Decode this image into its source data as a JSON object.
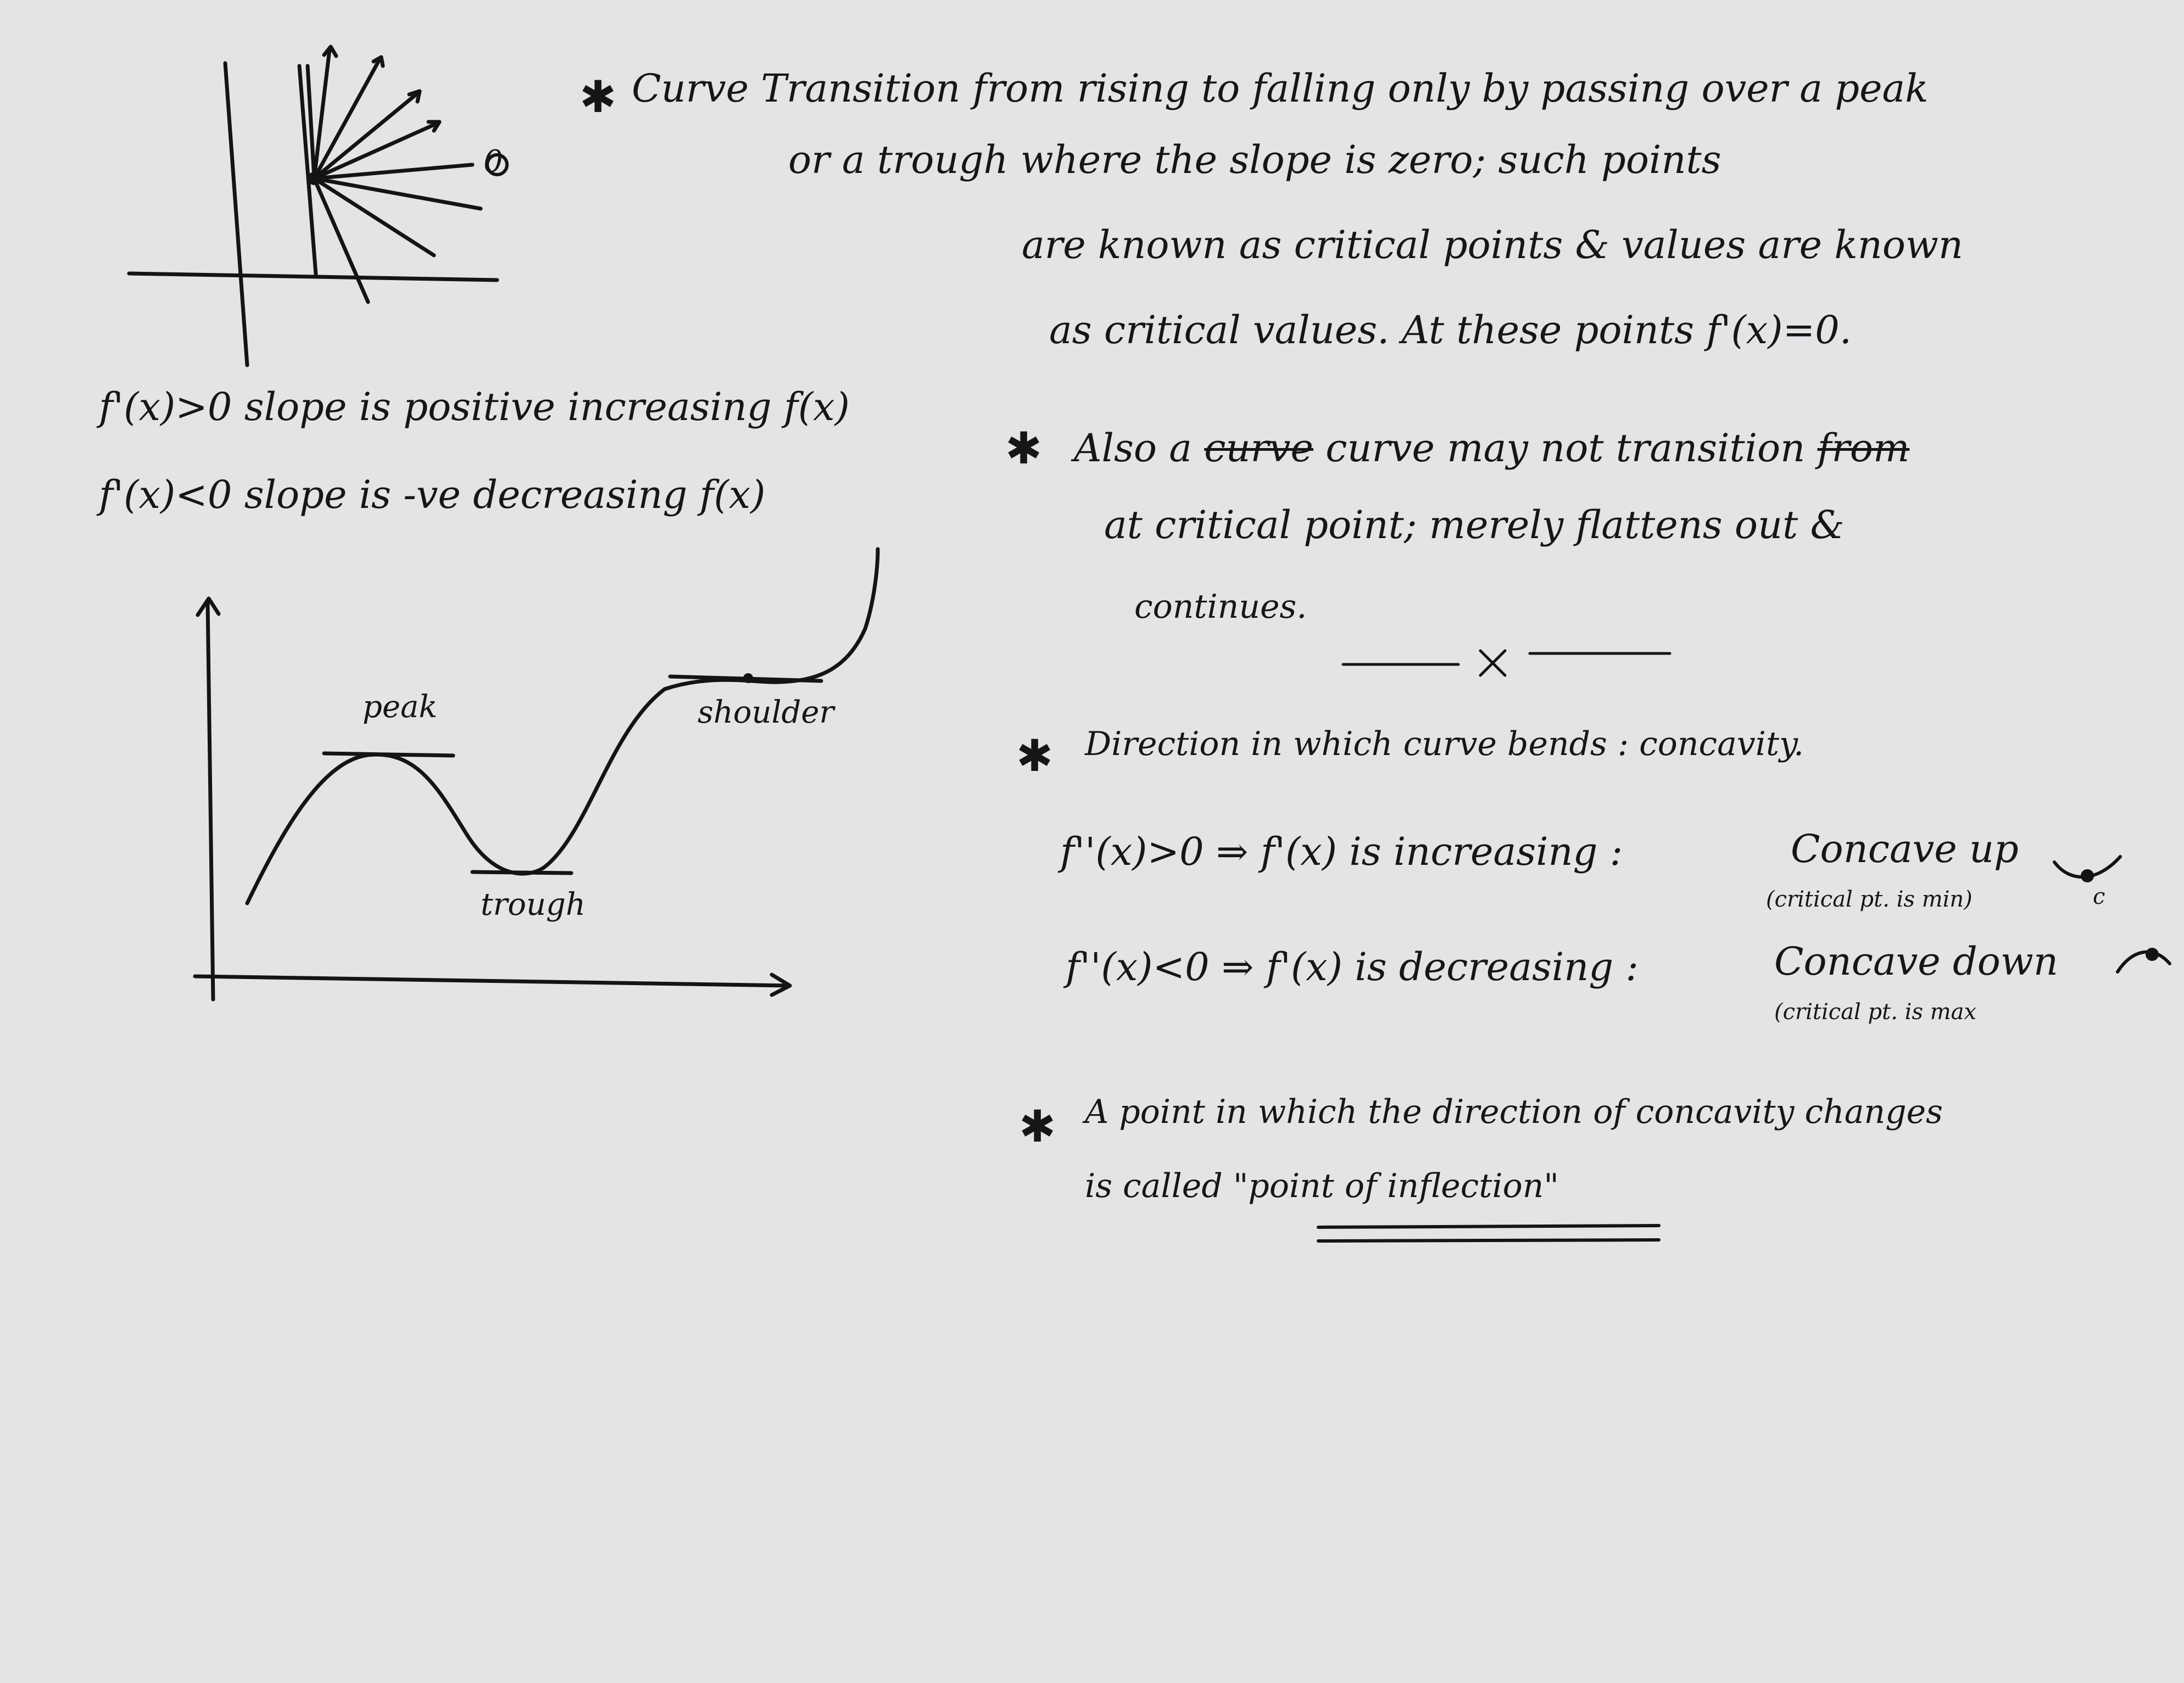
{
  "top_sketch": {
    "label_zero": "0"
  },
  "slope_rules": {
    "positive": "f'(x)>0 slope is positive increasing f(x)",
    "negative": "f'(x)<0 slope is -ve decreasing f(x)"
  },
  "curve_labels": {
    "peak": "peak",
    "trough": "trough",
    "shoulder": "shoulder"
  },
  "notes": {
    "critical": {
      "bullet": "✱",
      "line1": "Curve Transition from rising to falling only by passing over a peak",
      "line2": "or a trough where the slope is zero; such points",
      "line3": "are known as critical points & values are known",
      "line4": "as critical values. At these points f'(x)=0."
    },
    "flatten": {
      "bullet": "✱",
      "line1_pre": "Also a",
      "line1_struck": "curve",
      "line1_mid": "curve may not transition",
      "line1_struck2": "from",
      "line2": "at critical point; merely flattens out &",
      "line3": "continues."
    },
    "separator": "———— × ————",
    "concavity": {
      "bullet": "✱",
      "line1": "Direction in which curve bends : concavity.",
      "up_rule": "f''(x)>0 ⇒ f'(x) is increasing :",
      "up_result": "Concave up",
      "up_note": "(critical pt. is min)",
      "down_rule": "f''(x)<0 ⇒ f'(x) is decreasing :",
      "down_result": "Concave down",
      "down_note": "(critical pt. is max",
      "marker_c": "c"
    },
    "inflection": {
      "bullet": "✱",
      "line1": "A point in which the direction of concavity changes",
      "line2_pre": "is called",
      "line2_term": "\"point of inflection\""
    }
  }
}
